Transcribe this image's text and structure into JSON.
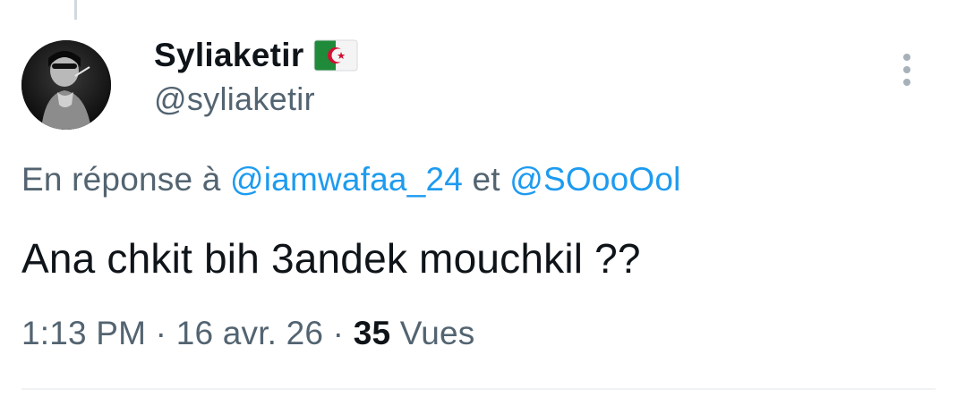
{
  "tweet": {
    "author": {
      "display_name": "Syliaketir",
      "flag_emoji": "algeria-flag-icon",
      "handle": "@syliaketir"
    },
    "reply_prefix": "En réponse à ",
    "reply_mentions": [
      "@iamwafaa_24",
      "@SOooOol"
    ],
    "reply_joiner": " et ",
    "text": "Ana chkit bih 3andek mouchkil ??",
    "time": "1:13 PM",
    "separator": " · ",
    "date": "16 avr. 26",
    "views_count": "35",
    "views_label": " Vues"
  },
  "colors": {
    "text_primary": "#0f1419",
    "text_secondary": "#536471",
    "link": "#1d9bf0",
    "divider": "#eff3f4"
  }
}
